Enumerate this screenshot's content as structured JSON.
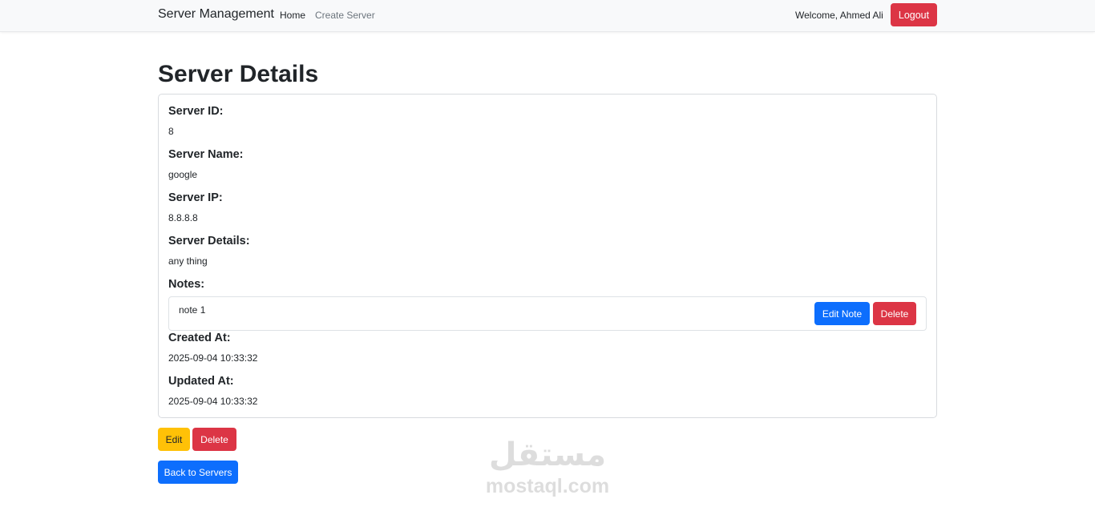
{
  "navbar": {
    "brand": "Server Management",
    "links": [
      "Home",
      "Create Server"
    ],
    "welcome": "Welcome, Ahmed Ali",
    "logout_label": "Logout"
  },
  "page": {
    "title": "Server Details"
  },
  "details": {
    "id_label": "Server ID:",
    "id_value": "8",
    "name_label": "Server Name:",
    "name_value": "google",
    "ip_label": "Server IP:",
    "ip_value": "8.8.8.8",
    "details_label": "Server Details:",
    "details_value": "any thing",
    "notes_label": "Notes:",
    "notes": [
      {
        "text": "note 1",
        "edit_label": "Edit Note",
        "delete_label": "Delete"
      }
    ],
    "created_label": "Created At:",
    "created_value": "2025-09-04 10:33:32",
    "updated_label": "Updated At:",
    "updated_value": "2025-09-04 10:33:32"
  },
  "actions": {
    "edit_label": "Edit",
    "delete_label": "Delete",
    "back_label": "Back to Servers"
  },
  "watermark": {
    "arabic": "مستقل",
    "latin": "mostaql.com"
  },
  "colors": {
    "primary": "#0d6efd",
    "danger": "#dc3545",
    "warning": "#ffc107",
    "navbar_bg": "#f8f9fa"
  }
}
